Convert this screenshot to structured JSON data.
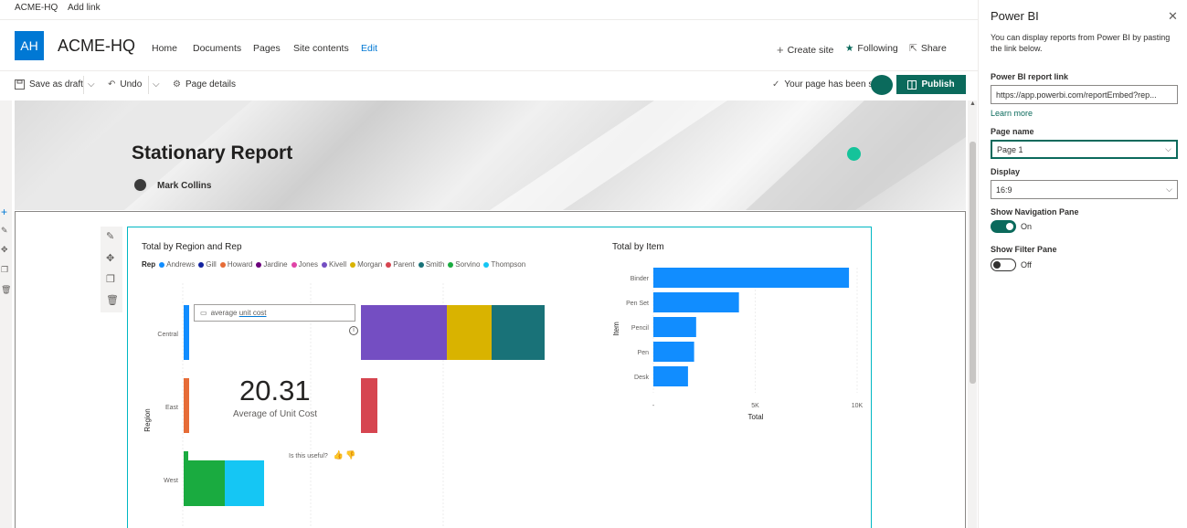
{
  "suitebar": {
    "site_link": "ACME-HQ",
    "add_link": "Add link"
  },
  "site": {
    "initials": "AH",
    "title": "ACME-HQ",
    "nav": [
      "Home",
      "Documents",
      "Pages",
      "Site contents",
      "Edit"
    ],
    "actions": {
      "create_site": "Create site",
      "following": "Following",
      "share": "Share"
    }
  },
  "commandbar": {
    "save_draft": "Save as draft",
    "undo": "Undo",
    "page_details": "Page details",
    "status": "Your page has been s",
    "publish": "Publish"
  },
  "page": {
    "title": "Stationary Report",
    "author": "Mark Collins"
  },
  "report": {
    "left_title": "Total by Region and Rep",
    "legend_label": "Rep",
    "legend": [
      {
        "name": "Andrews",
        "color": "#118dff"
      },
      {
        "name": "Gill",
        "color": "#12239e"
      },
      {
        "name": "Howard",
        "color": "#e66c37"
      },
      {
        "name": "Jardine",
        "color": "#6b007b"
      },
      {
        "name": "Jones",
        "color": "#e044a7"
      },
      {
        "name": "Kivell",
        "color": "#744ec2"
      },
      {
        "name": "Morgan",
        "color": "#d9b300"
      },
      {
        "name": "Parent",
        "color": "#d64550"
      },
      {
        "name": "Smith",
        "color": "#197278"
      },
      {
        "name": "Sorvino",
        "color": "#1aab40"
      },
      {
        "name": "Thompson",
        "color": "#15c6f4"
      }
    ],
    "qna_text_prefix": "average ",
    "qna_text_underlined": "unit cost",
    "kpi_value": "20.31",
    "kpi_label": "Average of Unit Cost",
    "useful": "Is this useful?",
    "y_axis_title": "Region",
    "right_title": "Total by Item"
  },
  "chart_data": [
    {
      "type": "bar",
      "title": "Total by Region and Rep",
      "ylabel": "Region",
      "categories": [
        "Central",
        "East",
        "West"
      ],
      "stacked": true,
      "orientation": "horizontal",
      "series": [
        {
          "name": "Andrews",
          "values": [
            null,
            null,
            null
          ]
        },
        {
          "name": "Kivell",
          "values": [
            null,
            null,
            null
          ]
        },
        {
          "name": "Morgan",
          "values": [
            null,
            null,
            null
          ]
        },
        {
          "name": "Smith",
          "values": [
            null,
            null,
            null
          ]
        },
        {
          "name": "Howard",
          "values": [
            null,
            null,
            null
          ]
        },
        {
          "name": "Parent",
          "values": [
            null,
            null,
            null
          ]
        },
        {
          "name": "Sorvino",
          "values": [
            null,
            null,
            null
          ]
        },
        {
          "name": "Thompson",
          "values": [
            null,
            null,
            null
          ]
        }
      ]
    },
    {
      "type": "bar",
      "orientation": "horizontal",
      "title": "Total by Item",
      "xlabel": "Total",
      "ylabel": "Item",
      "categories": [
        "Binder",
        "Pen Set",
        "Pencil",
        "Pen",
        "Desk"
      ],
      "values": [
        9600,
        4200,
        2100,
        2000,
        1700
      ],
      "xlim": [
        0,
        10000
      ],
      "x_ticks": [
        "-",
        "5K",
        "10K"
      ],
      "color": "#118dff"
    }
  ],
  "panel": {
    "title": "Power BI",
    "description": "You can display reports from Power BI by pasting the link below.",
    "link_label": "Power BI report link",
    "link_value": "https://app.powerbi.com/reportEmbed?rep...",
    "learn_more": "Learn more",
    "page_name_label": "Page name",
    "page_name_value": "Page 1",
    "display_label": "Display",
    "display_value": "16:9",
    "nav_pane_label": "Show Navigation Pane",
    "nav_pane_state": "On",
    "filter_pane_label": "Show Filter Pane",
    "filter_pane_state": "Off"
  }
}
